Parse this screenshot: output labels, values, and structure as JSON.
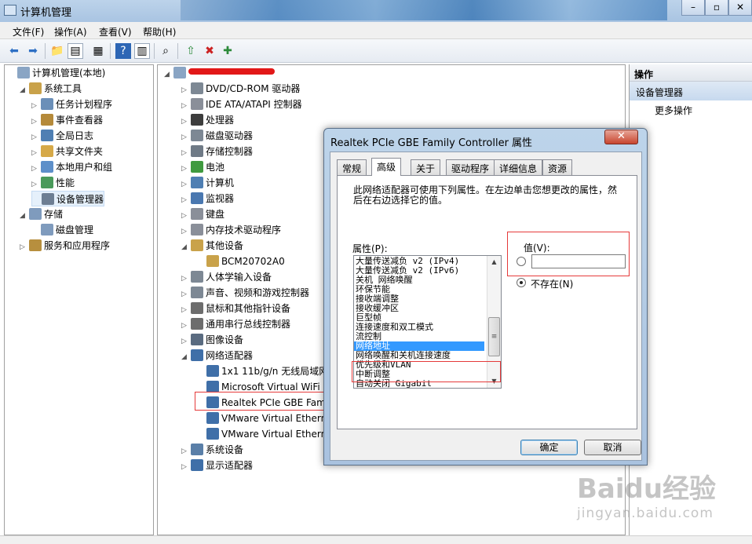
{
  "window": {
    "title": "计算机管理"
  },
  "menu": [
    "文件(F)",
    "操作(A)",
    "查看(V)",
    "帮助(H)"
  ],
  "left_tree": [
    {
      "label": "计算机管理(本地)",
      "level": 0,
      "arrow": ""
    },
    {
      "label": "系统工具",
      "level": 1,
      "arrow": "◢"
    },
    {
      "label": "任务计划程序",
      "level": 2,
      "arrow": "▷"
    },
    {
      "label": "事件查看器",
      "level": 2,
      "arrow": "▷"
    },
    {
      "label": "全局日志",
      "level": 2,
      "arrow": "▷"
    },
    {
      "label": "共享文件夹",
      "level": 2,
      "arrow": "▷"
    },
    {
      "label": "本地用户和组",
      "level": 2,
      "arrow": "▷"
    },
    {
      "label": "性能",
      "level": 2,
      "arrow": "▷"
    },
    {
      "label": "设备管理器",
      "level": 2,
      "arrow": "",
      "selected": true
    },
    {
      "label": "存储",
      "level": 1,
      "arrow": "◢"
    },
    {
      "label": "磁盘管理",
      "level": 2,
      "arrow": ""
    },
    {
      "label": "服务和应用程序",
      "level": 1,
      "arrow": "▷"
    }
  ],
  "device_tree": [
    {
      "label": "DVD/CD-ROM 驱动器",
      "level": 1,
      "arrow": "▷"
    },
    {
      "label": "IDE ATA/ATAPI 控制器",
      "level": 1,
      "arrow": "▷"
    },
    {
      "label": "处理器",
      "level": 1,
      "arrow": "▷"
    },
    {
      "label": "磁盘驱动器",
      "level": 1,
      "arrow": "▷"
    },
    {
      "label": "存储控制器",
      "level": 1,
      "arrow": "▷"
    },
    {
      "label": "电池",
      "level": 1,
      "arrow": "▷"
    },
    {
      "label": "计算机",
      "level": 1,
      "arrow": "▷"
    },
    {
      "label": "监视器",
      "level": 1,
      "arrow": "▷"
    },
    {
      "label": "键盘",
      "level": 1,
      "arrow": "▷"
    },
    {
      "label": "内存技术驱动程序",
      "level": 1,
      "arrow": "▷"
    },
    {
      "label": "其他设备",
      "level": 1,
      "arrow": "◢"
    },
    {
      "label": "BCM20702A0",
      "level": 2,
      "arrow": ""
    },
    {
      "label": "人体学输入设备",
      "level": 1,
      "arrow": "▷"
    },
    {
      "label": "声音、视频和游戏控制器",
      "level": 1,
      "arrow": "▷"
    },
    {
      "label": "鼠标和其他指针设备",
      "level": 1,
      "arrow": "▷"
    },
    {
      "label": "通用串行总线控制器",
      "level": 1,
      "arrow": "▷"
    },
    {
      "label": "图像设备",
      "level": 1,
      "arrow": "▷"
    },
    {
      "label": "网络适配器",
      "level": 1,
      "arrow": "◢"
    },
    {
      "label": "1x1 11b/g/n 无线局域网",
      "level": 2,
      "arrow": ""
    },
    {
      "label": "Microsoft Virtual WiFi",
      "level": 2,
      "arrow": ""
    },
    {
      "label": "Realtek PCIe GBE Fam",
      "level": 2,
      "arrow": ""
    },
    {
      "label": "VMware Virtual Ethern",
      "level": 2,
      "arrow": ""
    },
    {
      "label": "VMware Virtual Ethern",
      "level": 2,
      "arrow": ""
    },
    {
      "label": "系统设备",
      "level": 1,
      "arrow": "▷"
    },
    {
      "label": "显示适配器",
      "level": 1,
      "arrow": "▷"
    }
  ],
  "actions": {
    "header": "操作",
    "section": "设备管理器",
    "more": "更多操作"
  },
  "dialog": {
    "title": "Realtek PCIe GBE Family Controller 属性",
    "close": "✕",
    "tabs": [
      "常规",
      "高级",
      "关于",
      "驱动程序",
      "详细信息",
      "资源"
    ],
    "active_tab": "高级",
    "description": "此网络适配器可使用下列属性。在左边单击您想更改的属性，然后在右边选择它的值。",
    "property_label": "属性(P):",
    "properties": [
      "大量传送减负 v2 (IPv4)",
      "大量传送减负 v2 (IPv6)",
      "关机 网络唤醒",
      "环保节能",
      "接收端调整",
      "接收缓冲区",
      "巨型帧",
      "连接速度和双工模式",
      "流控制",
      "网络地址",
      "网络唤醒和关机连接速度",
      "优先级和VLAN",
      "中断调整",
      "自动关闭 Gigabit"
    ],
    "selected_property": "网络地址",
    "value_label": "值(V):",
    "value": "",
    "absent_label": "不存在(N)",
    "ok": "确定",
    "cancel": "取消"
  },
  "watermark": {
    "logo": "Baidu经验",
    "url": "jingyan.baidu.com"
  }
}
